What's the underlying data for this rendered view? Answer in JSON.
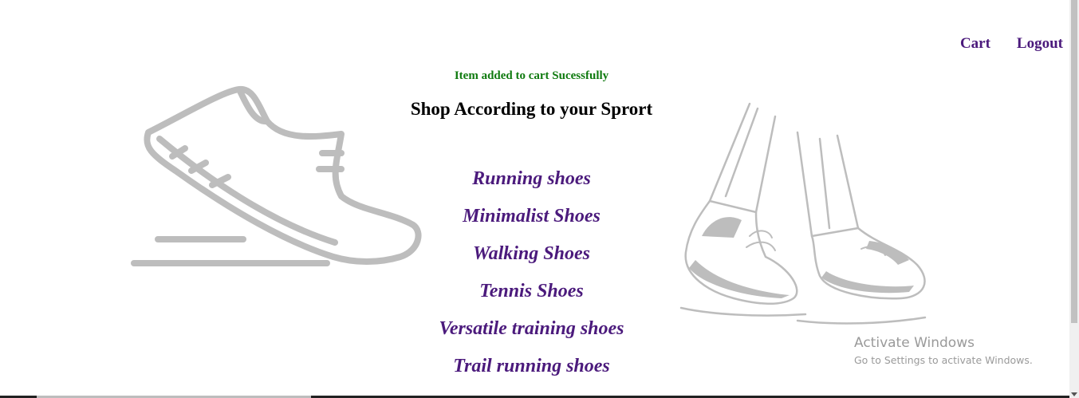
{
  "header": {
    "cart_label": "Cart",
    "logout_label": "Logout"
  },
  "flash": {
    "message": "Item added to cart Sucessfully"
  },
  "main": {
    "title": "Shop According to your Sprort",
    "categories": [
      "Running shoes",
      "Minimalist Shoes",
      "Walking Shoes",
      "Tennis Shoes",
      "Versatile training shoes",
      "Trail running shoes"
    ]
  },
  "watermark": {
    "title": "Activate Windows",
    "subtitle": "Go to Settings to activate Windows."
  },
  "colors": {
    "link": "#4b1a7c",
    "flash": "#0f7a0f",
    "illustration": "#bdbdbd"
  }
}
